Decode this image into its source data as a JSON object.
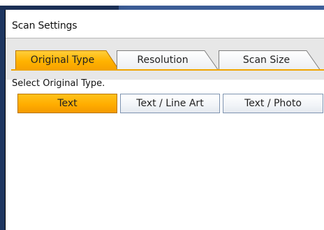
{
  "panel": {
    "title": "Scan Settings",
    "instruction": "Select Original Type."
  },
  "tabs": [
    {
      "label": "Original Type",
      "active": true
    },
    {
      "label": "Resolution",
      "active": false
    },
    {
      "label": "Scan Size",
      "active": false
    }
  ],
  "options": [
    {
      "label": "Text",
      "selected": true
    },
    {
      "label": "Text / Line Art",
      "selected": false
    },
    {
      "label": "Text / Photo",
      "selected": false
    }
  ],
  "colors": {
    "accent": "#ffad00",
    "header_bar": "#3e5f99",
    "button_border": "#7e93b0",
    "tab_background": "#e7e7e7"
  }
}
